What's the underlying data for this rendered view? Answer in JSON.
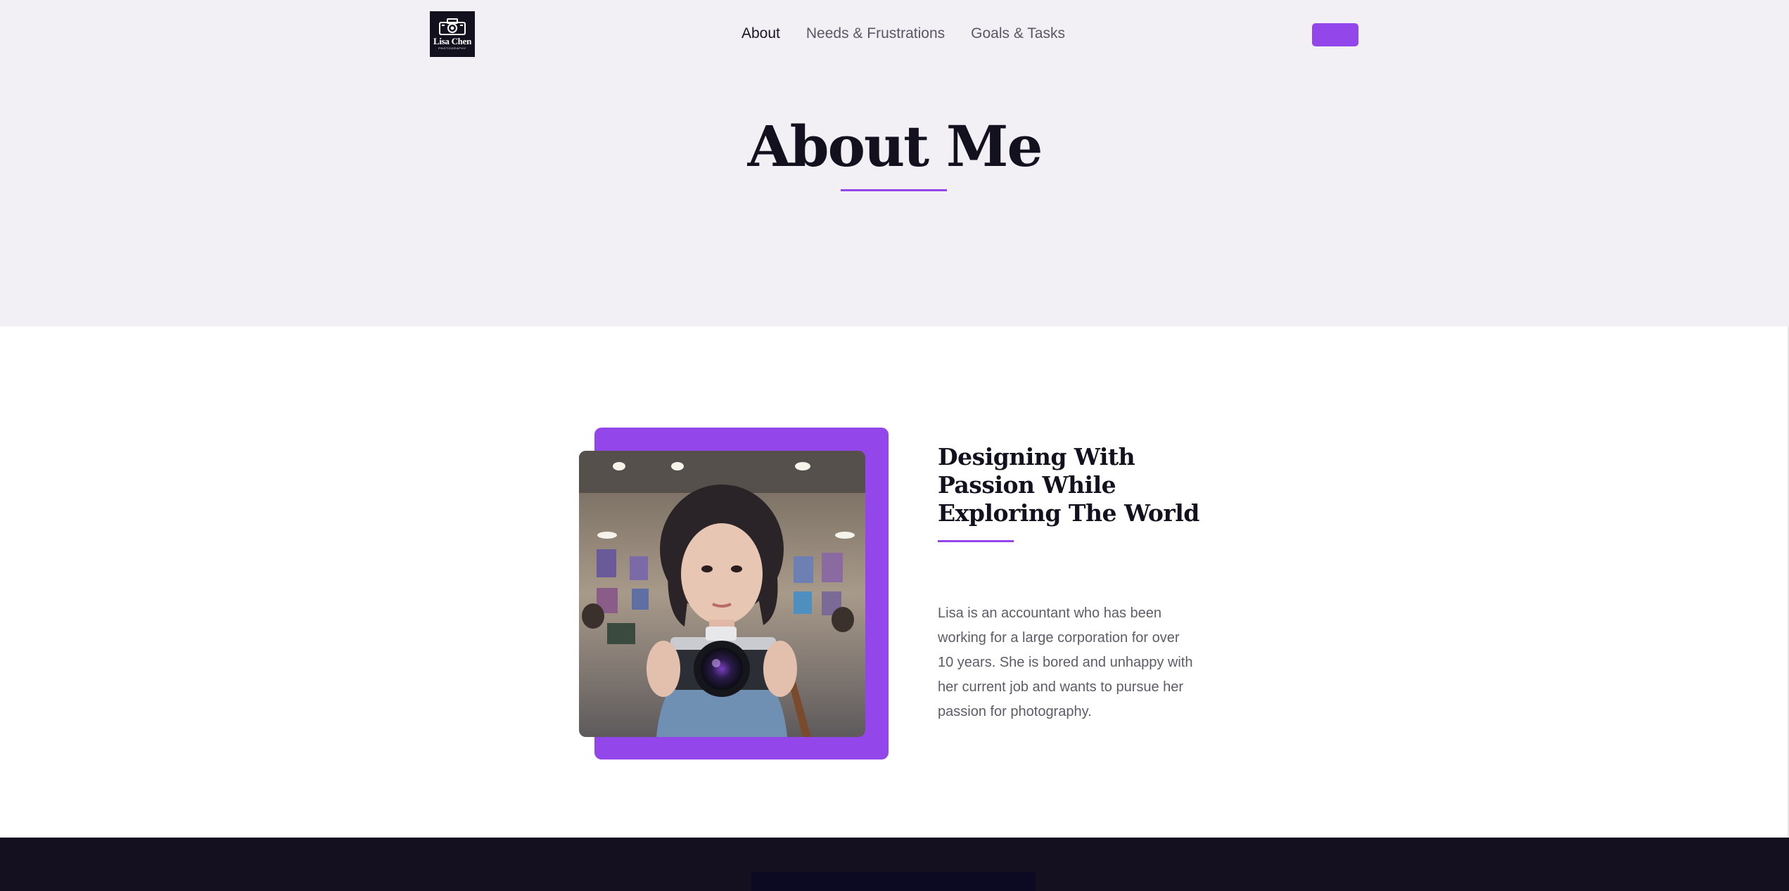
{
  "brand": {
    "name": "Lisa Chen",
    "tagline": "PHOTOGRAPHY"
  },
  "nav": {
    "items": [
      {
        "label": "About",
        "active": true
      },
      {
        "label": "Needs & Frustrations",
        "active": false
      },
      {
        "label": "Goals & Tasks",
        "active": false
      }
    ],
    "cta_label": ""
  },
  "hero": {
    "title": "About Me"
  },
  "about": {
    "heading": "Designing With Passion While Exploring The World",
    "body": "Lisa is an accountant who has been working for a large corporation for over 10 years. She is bored and unhappy with her current job and wants to pursue her passion for photography."
  },
  "colors": {
    "accent": "#9347ea",
    "dark": "#14111f",
    "hero_bg": "#f2f0f5",
    "footer_bg": "#14101f",
    "text_muted": "#5f5b68"
  },
  "icons": {
    "logo": "camera-icon"
  }
}
